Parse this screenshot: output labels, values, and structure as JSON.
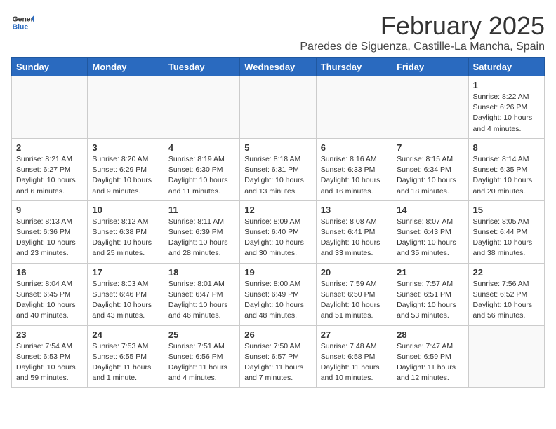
{
  "logo": {
    "general": "General",
    "blue": "Blue"
  },
  "header": {
    "month": "February 2025",
    "location": "Paredes de Siguenza, Castille-La Mancha, Spain"
  },
  "weekdays": [
    "Sunday",
    "Monday",
    "Tuesday",
    "Wednesday",
    "Thursday",
    "Friday",
    "Saturday"
  ],
  "weeks": [
    [
      {
        "day": "",
        "info": ""
      },
      {
        "day": "",
        "info": ""
      },
      {
        "day": "",
        "info": ""
      },
      {
        "day": "",
        "info": ""
      },
      {
        "day": "",
        "info": ""
      },
      {
        "day": "",
        "info": ""
      },
      {
        "day": "1",
        "info": "Sunrise: 8:22 AM\nSunset: 6:26 PM\nDaylight: 10 hours\nand 4 minutes."
      }
    ],
    [
      {
        "day": "2",
        "info": "Sunrise: 8:21 AM\nSunset: 6:27 PM\nDaylight: 10 hours\nand 6 minutes."
      },
      {
        "day": "3",
        "info": "Sunrise: 8:20 AM\nSunset: 6:29 PM\nDaylight: 10 hours\nand 9 minutes."
      },
      {
        "day": "4",
        "info": "Sunrise: 8:19 AM\nSunset: 6:30 PM\nDaylight: 10 hours\nand 11 minutes."
      },
      {
        "day": "5",
        "info": "Sunrise: 8:18 AM\nSunset: 6:31 PM\nDaylight: 10 hours\nand 13 minutes."
      },
      {
        "day": "6",
        "info": "Sunrise: 8:16 AM\nSunset: 6:33 PM\nDaylight: 10 hours\nand 16 minutes."
      },
      {
        "day": "7",
        "info": "Sunrise: 8:15 AM\nSunset: 6:34 PM\nDaylight: 10 hours\nand 18 minutes."
      },
      {
        "day": "8",
        "info": "Sunrise: 8:14 AM\nSunset: 6:35 PM\nDaylight: 10 hours\nand 20 minutes."
      }
    ],
    [
      {
        "day": "9",
        "info": "Sunrise: 8:13 AM\nSunset: 6:36 PM\nDaylight: 10 hours\nand 23 minutes."
      },
      {
        "day": "10",
        "info": "Sunrise: 8:12 AM\nSunset: 6:38 PM\nDaylight: 10 hours\nand 25 minutes."
      },
      {
        "day": "11",
        "info": "Sunrise: 8:11 AM\nSunset: 6:39 PM\nDaylight: 10 hours\nand 28 minutes."
      },
      {
        "day": "12",
        "info": "Sunrise: 8:09 AM\nSunset: 6:40 PM\nDaylight: 10 hours\nand 30 minutes."
      },
      {
        "day": "13",
        "info": "Sunrise: 8:08 AM\nSunset: 6:41 PM\nDaylight: 10 hours\nand 33 minutes."
      },
      {
        "day": "14",
        "info": "Sunrise: 8:07 AM\nSunset: 6:43 PM\nDaylight: 10 hours\nand 35 minutes."
      },
      {
        "day": "15",
        "info": "Sunrise: 8:05 AM\nSunset: 6:44 PM\nDaylight: 10 hours\nand 38 minutes."
      }
    ],
    [
      {
        "day": "16",
        "info": "Sunrise: 8:04 AM\nSunset: 6:45 PM\nDaylight: 10 hours\nand 40 minutes."
      },
      {
        "day": "17",
        "info": "Sunrise: 8:03 AM\nSunset: 6:46 PM\nDaylight: 10 hours\nand 43 minutes."
      },
      {
        "day": "18",
        "info": "Sunrise: 8:01 AM\nSunset: 6:47 PM\nDaylight: 10 hours\nand 46 minutes."
      },
      {
        "day": "19",
        "info": "Sunrise: 8:00 AM\nSunset: 6:49 PM\nDaylight: 10 hours\nand 48 minutes."
      },
      {
        "day": "20",
        "info": "Sunrise: 7:59 AM\nSunset: 6:50 PM\nDaylight: 10 hours\nand 51 minutes."
      },
      {
        "day": "21",
        "info": "Sunrise: 7:57 AM\nSunset: 6:51 PM\nDaylight: 10 hours\nand 53 minutes."
      },
      {
        "day": "22",
        "info": "Sunrise: 7:56 AM\nSunset: 6:52 PM\nDaylight: 10 hours\nand 56 minutes."
      }
    ],
    [
      {
        "day": "23",
        "info": "Sunrise: 7:54 AM\nSunset: 6:53 PM\nDaylight: 10 hours\nand 59 minutes."
      },
      {
        "day": "24",
        "info": "Sunrise: 7:53 AM\nSunset: 6:55 PM\nDaylight: 11 hours\nand 1 minute."
      },
      {
        "day": "25",
        "info": "Sunrise: 7:51 AM\nSunset: 6:56 PM\nDaylight: 11 hours\nand 4 minutes."
      },
      {
        "day": "26",
        "info": "Sunrise: 7:50 AM\nSunset: 6:57 PM\nDaylight: 11 hours\nand 7 minutes."
      },
      {
        "day": "27",
        "info": "Sunrise: 7:48 AM\nSunset: 6:58 PM\nDaylight: 11 hours\nand 10 minutes."
      },
      {
        "day": "28",
        "info": "Sunrise: 7:47 AM\nSunset: 6:59 PM\nDaylight: 11 hours\nand 12 minutes."
      },
      {
        "day": "",
        "info": ""
      }
    ]
  ]
}
